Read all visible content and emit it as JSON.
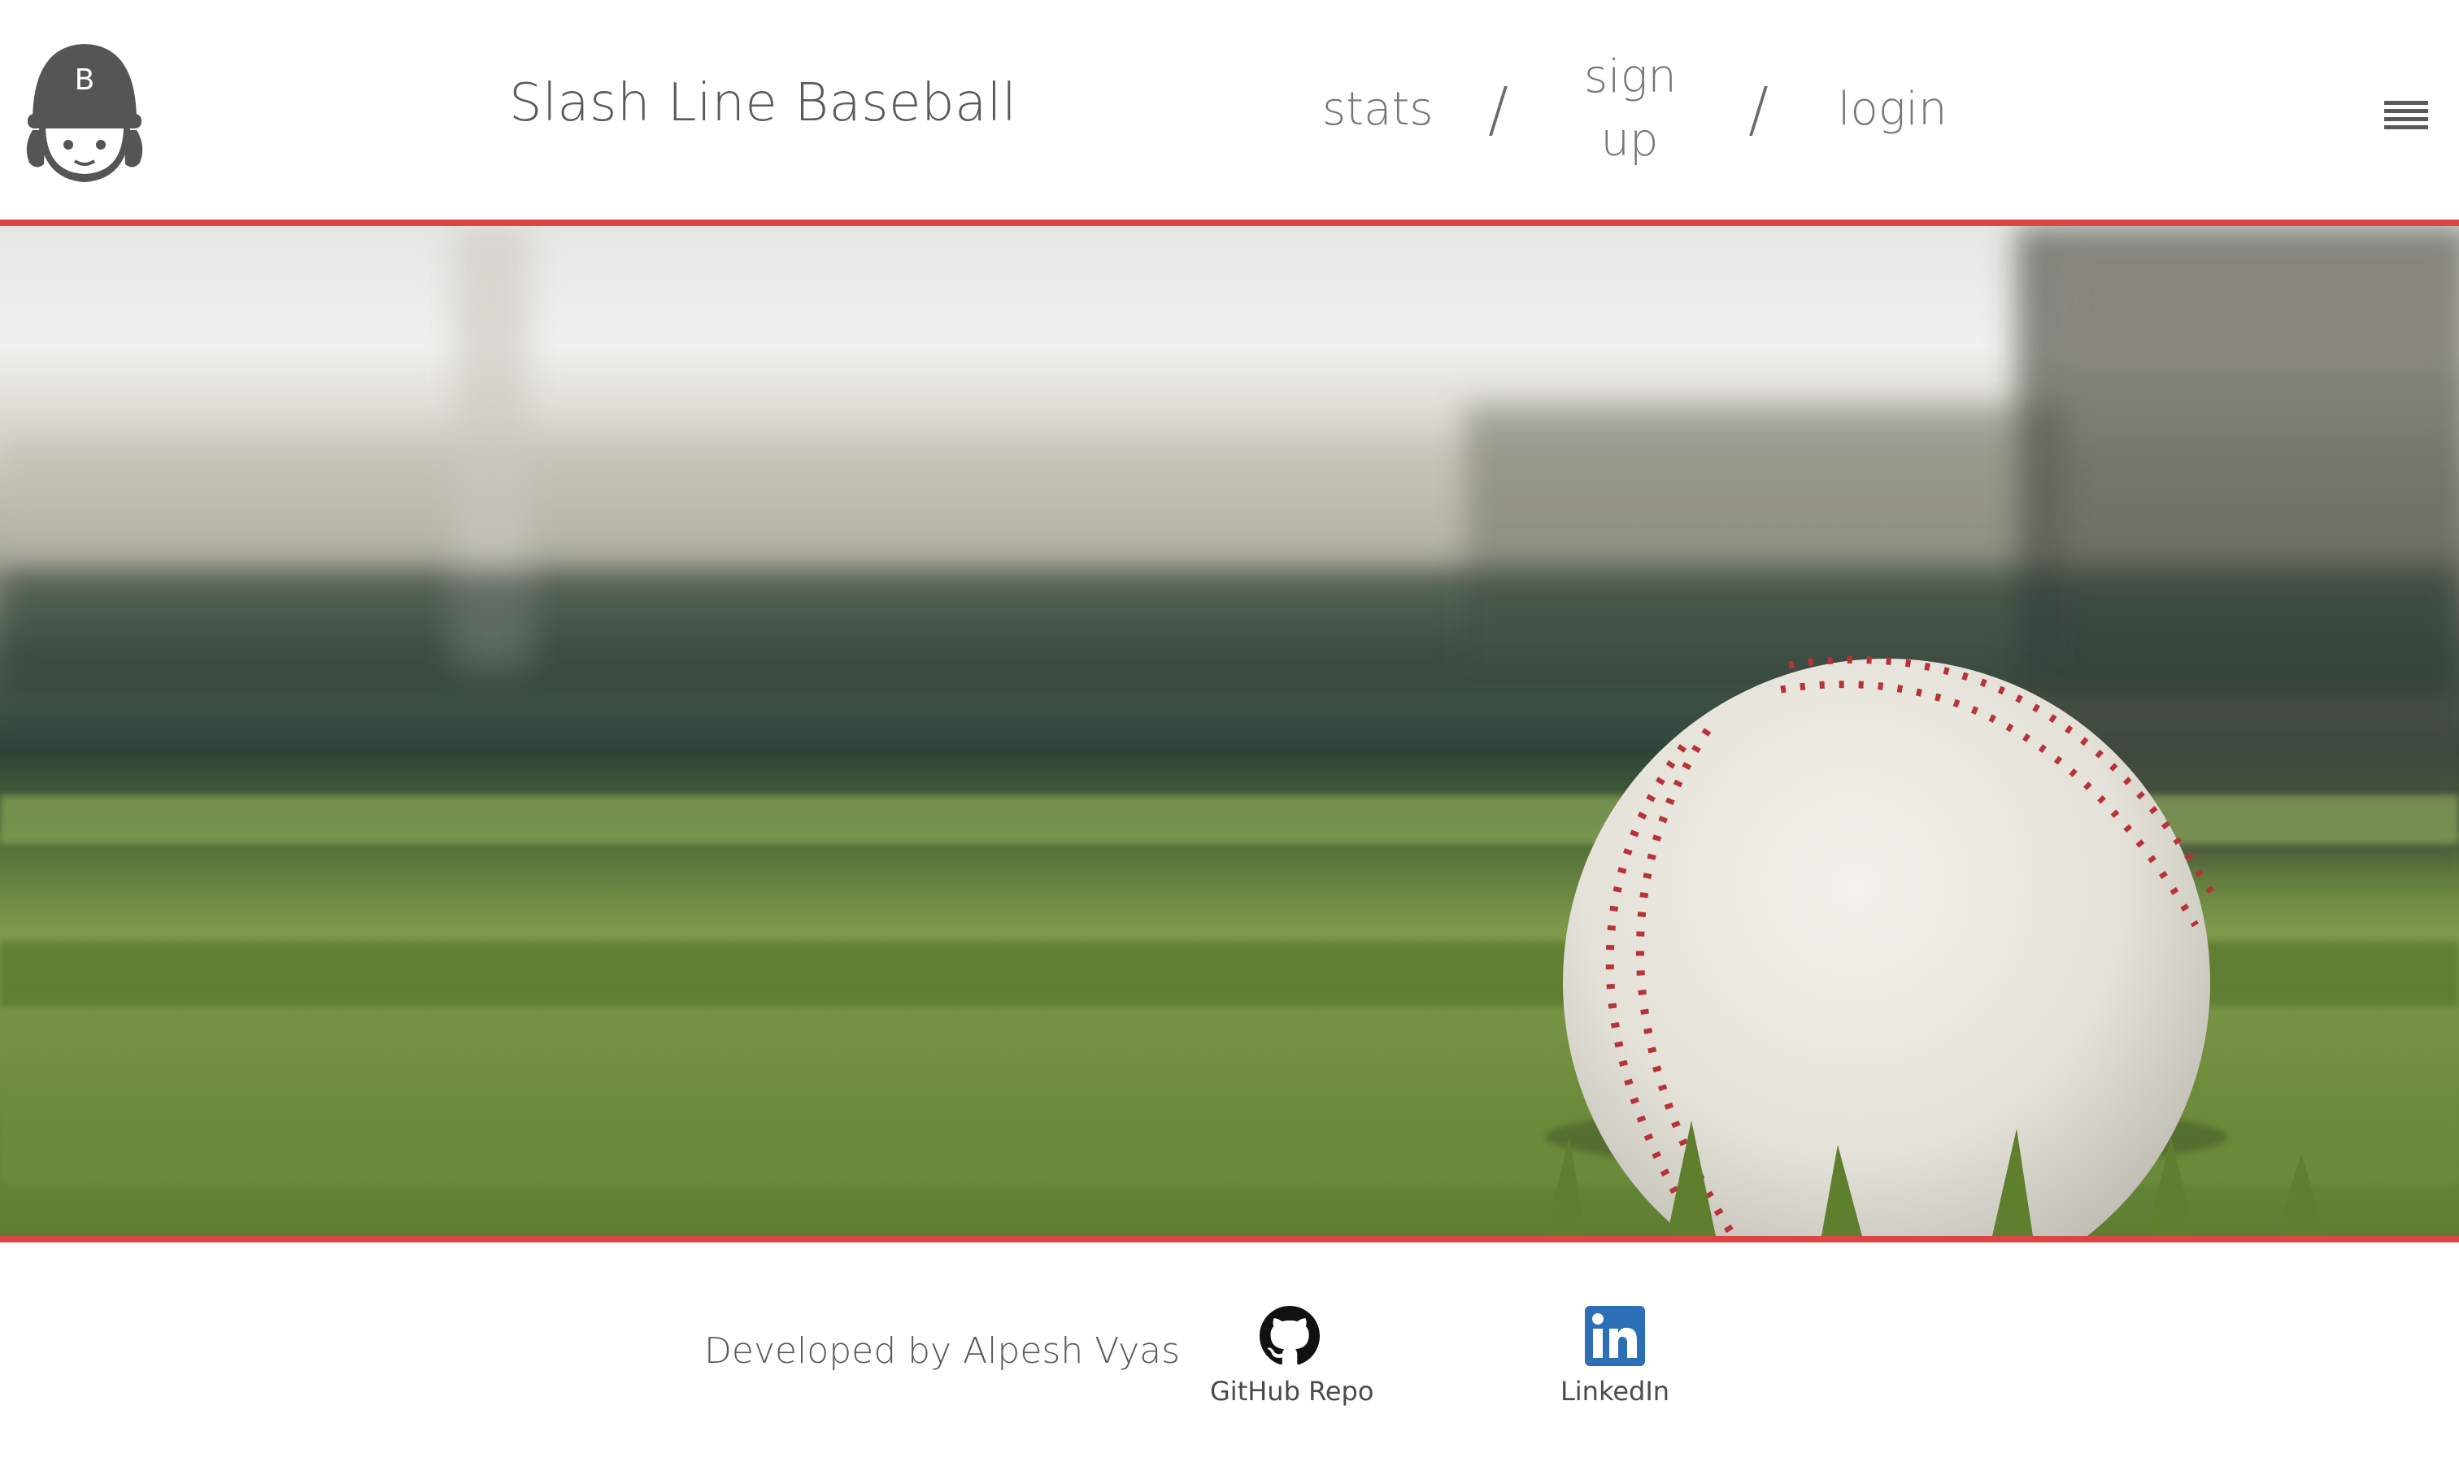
{
  "header": {
    "logo_letter": "B",
    "title": "Slash Line Baseball",
    "nav": {
      "stats": "stats",
      "sep1": "/",
      "signup_line1": "sign",
      "signup_line2": "up",
      "sep2": "/",
      "login": "login"
    },
    "menu_icon": "hamburger-menu-icon"
  },
  "hero": {
    "image": "baseball-on-grass",
    "accent_color": "#dd4444"
  },
  "footer": {
    "credit": "Developed by Alpesh Vyas",
    "github_label": "GitHub Repo",
    "linkedin_label": "LinkedIn",
    "linkedin_color": "#2d6fb7"
  }
}
